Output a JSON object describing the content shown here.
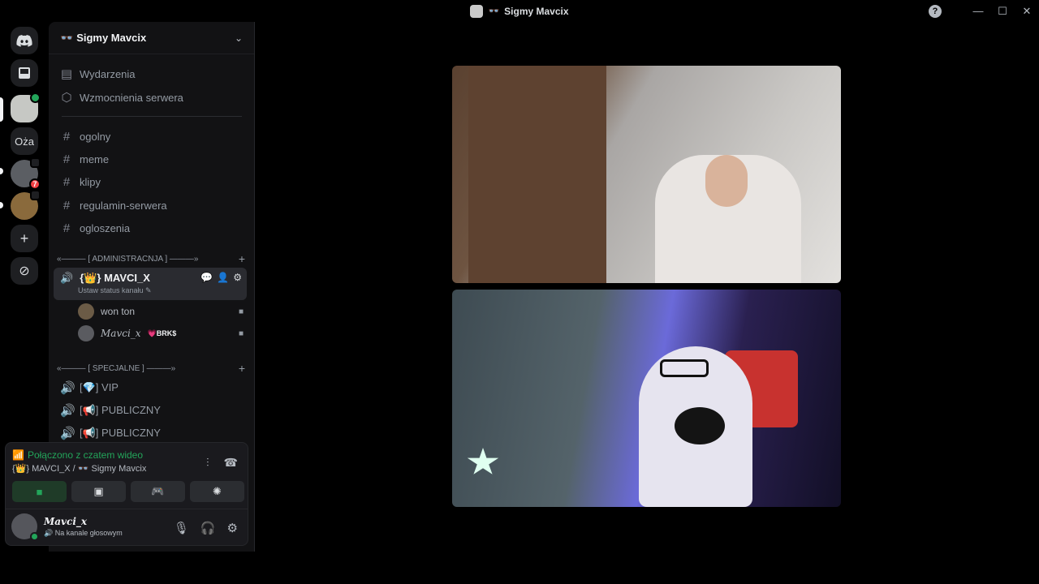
{
  "window": {
    "title": "Sigmy Mavcix",
    "title_emoji": "👓",
    "help_label": "?",
    "min_label": "—",
    "max_label": "☐",
    "close_label": "✕"
  },
  "rail": {
    "discord_icon": "discord-logo-icon",
    "inbox_icon": "inbox-icon",
    "text_server_label": "Oża",
    "mention_badge": "7",
    "add_label": "+",
    "discover_label": "⊘"
  },
  "server": {
    "name": "Sigmy Mavcix",
    "emoji": "👓"
  },
  "sidebar": {
    "events": "Wydarzenia",
    "boosts": "Wzmocnienia serwera",
    "text_channels": [
      "ogolny",
      "meme",
      "klipy",
      "regulamin-serwera",
      "ogloszenia"
    ],
    "category_admin": "«——— [ ADMINISTRACNJA ] ———»",
    "voice_active": {
      "name": "{👑} MAVCI_X",
      "status": "Ustaw status kanału"
    },
    "members": [
      {
        "name": "won ton",
        "tag": ""
      },
      {
        "name": "𝑀𝑎𝑣𝑐𝑖_𝑥",
        "tag": "💗BRK$"
      }
    ],
    "category_special": "«——— [ SPECJALNE ] ———»",
    "voice_channels": [
      "[💎] VIP",
      "[📢] PUBLICZNY",
      "[📢] PUBLICZNY"
    ]
  },
  "voice_panel": {
    "status": "Połączono z czatem wideo",
    "location": "{👑} MAVCI_X / 👓 Sigmy Mavcix",
    "user_name": "𝑴𝒂𝒗𝒄𝒊_𝒙",
    "user_status": "Na kanale głosowym"
  },
  "colors": {
    "accent_green": "#23a55a",
    "danger": "#f23f43",
    "sidebar_bg": "#121214"
  }
}
